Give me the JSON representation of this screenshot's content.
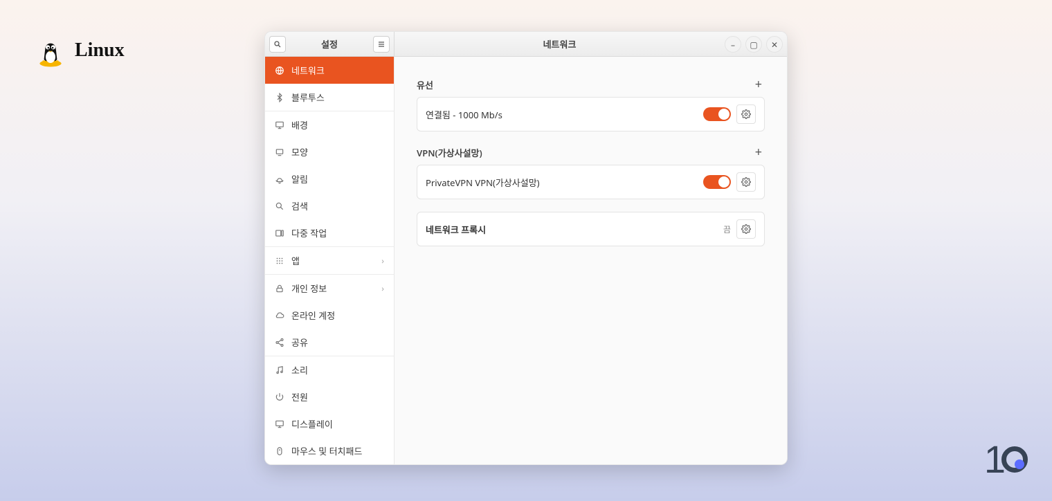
{
  "logo": {
    "text": "Linux"
  },
  "window": {
    "sidebar_title": "설정",
    "main_title": "네트워크"
  },
  "sidebar": {
    "items": [
      {
        "id": "network",
        "icon": "globe",
        "label": "네트워크",
        "active": true
      },
      {
        "id": "bluetooth",
        "icon": "bluetooth",
        "label": "블루투스"
      },
      {
        "id": "background",
        "icon": "desktop",
        "label": "배경"
      },
      {
        "id": "appearance",
        "icon": "display-sm",
        "label": "모양"
      },
      {
        "id": "notif",
        "icon": "bell",
        "label": "알림"
      },
      {
        "id": "search",
        "icon": "search",
        "label": "검색"
      },
      {
        "id": "multitask",
        "icon": "multitask",
        "label": "다중 작업"
      },
      {
        "id": "apps",
        "icon": "grid",
        "label": "앱",
        "chevron": true
      },
      {
        "id": "privacy",
        "icon": "lock",
        "label": "개인 정보",
        "chevron": true
      },
      {
        "id": "online",
        "icon": "cloud",
        "label": "온라인 계정"
      },
      {
        "id": "share",
        "icon": "share",
        "label": "공유"
      },
      {
        "id": "sound",
        "icon": "music",
        "label": "소리"
      },
      {
        "id": "power",
        "icon": "power",
        "label": "전원"
      },
      {
        "id": "display",
        "icon": "display",
        "label": "디스플레이"
      },
      {
        "id": "mouse",
        "icon": "mouse",
        "label": "마우스 및 터치패드"
      }
    ],
    "dividers_after": [
      1,
      6,
      7,
      10
    ]
  },
  "content": {
    "wired": {
      "title": "유선",
      "connection_label": "연결됨 - 1000 Mb/s",
      "enabled": true
    },
    "vpn": {
      "title": "VPN(가상사설망)",
      "connection_label": "PrivateVPN VPN(가상사설망)",
      "enabled": true
    },
    "proxy": {
      "title": "네트워크 프록시",
      "status": "끔"
    }
  },
  "brand_10": "10",
  "accent": "#e95420"
}
